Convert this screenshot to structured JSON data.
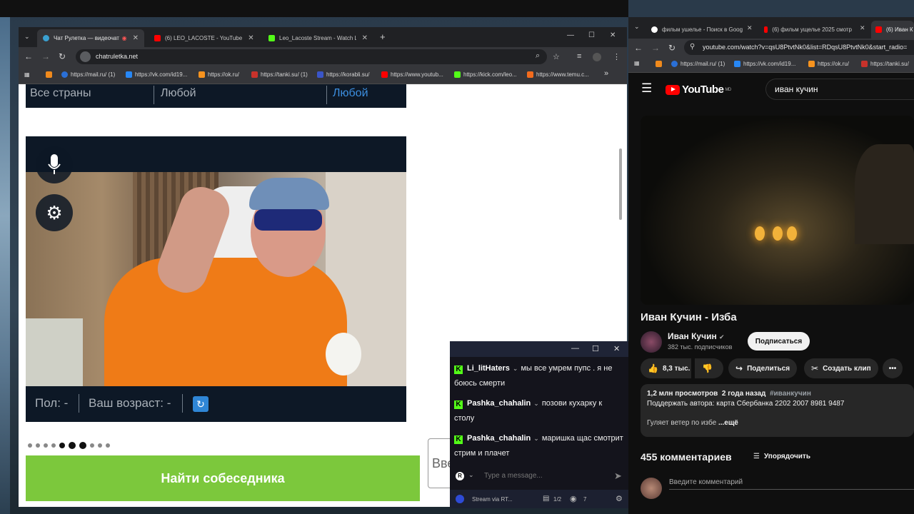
{
  "left_browser": {
    "tabs": [
      {
        "label": "Чат Рулетка — видеочат с",
        "icon": "chatruletka-icon",
        "active": true
      },
      {
        "label": "(6) LEO_LACOSTE - YouTube",
        "icon": "youtube-icon",
        "active": false
      },
      {
        "label": "Leo_Lacoste Stream - Watch Li",
        "icon": "kick-icon",
        "active": false
      }
    ],
    "new_tab": "+",
    "url": "chatruletka.net",
    "bookmarks": [
      "https://mail.ru/ (1)",
      "https://vk.com/id19...",
      "https://ok.ru/",
      "https://tanki.su/ (1)",
      "https://korabli.su/",
      "https://www.youtub...",
      "https://kick.com/leo...",
      "https://www.temu.c..."
    ],
    "bookmarks_more": "»"
  },
  "chatruletka": {
    "filters": {
      "country": "Все страны",
      "gender": "Любой",
      "age": "Любой"
    },
    "video_info": {
      "gender_label": "Пол: -",
      "age_label": "Ваш возраст: -"
    },
    "find_button": "Найти собеседника",
    "message_input_placeholder": "Вве"
  },
  "chat_overlay": {
    "window_controls": [
      "—",
      "☐",
      "✕"
    ],
    "messages": [
      {
        "user": "Li_litHaters",
        "text": "мы все умрем пупс . я не боюсь смерти"
      },
      {
        "user": "Pashka_chahalin",
        "text": "позови кухарку к столу"
      },
      {
        "user": "Pashka_chahalin",
        "text": "маришка щас смотрит стрим и плачет"
      }
    ],
    "input_placeholder": "Type a message...",
    "footer": {
      "source": "Stream via RT...",
      "page": "1/2",
      "viewers": "7"
    }
  },
  "right_browser": {
    "tabs": [
      {
        "label": "фильм ушелье - Поиск в Goog",
        "icon": "google-icon"
      },
      {
        "label": "(6) фильм ущелье 2025 смотр",
        "icon": "youtube-icon"
      },
      {
        "label": "(6) Иван К",
        "icon": "youtube-icon"
      }
    ],
    "url": "youtube.com/watch?v=qsU8PtvtNk0&list=RDqsU8PtvtNk0&start_radio=",
    "bookmarks": [
      "https://mail.ru/ (1)",
      "https://vk.com/id19...",
      "https://ok.ru/",
      "https://tanki.su/"
    ]
  },
  "youtube": {
    "logo": "YouTube",
    "logo_region": "MD",
    "search_query": "иван кучин",
    "video_title": "Иван Кучин - Изба",
    "channel_name": "Иван Кучин",
    "subscribers": "382 тыс. подписчиков",
    "subscribe_label": "Подписаться",
    "likes": "8,3 тыс.",
    "share_label": "Поделиться",
    "clip_label": "Создать клип",
    "more_label": "•••",
    "description": {
      "views": "1,2 млн просмотров",
      "date": "2 года назад",
      "hashtag": "#иванкучин",
      "support": "Поддержать автора: карта Сбербанка 2202 2007 8981 9487",
      "snippet": "Гуляет ветер по избе",
      "more": "...ещё"
    },
    "comments_header": "455 комментариев",
    "sort_label": "Упорядочить",
    "comment_placeholder": "Введите комментарий"
  }
}
